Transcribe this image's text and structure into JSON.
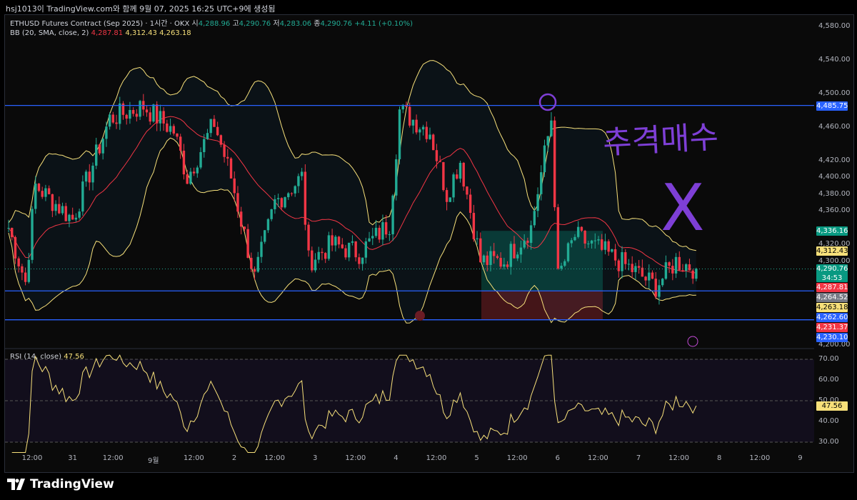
{
  "header": "hsj1013이 TradingView.com와 함께 9월 07, 2025 16:25 UTC+9에 생성됨",
  "legend": {
    "symbol": "ETHUSD Futures Contract (Sep 2025) · 1시간 · OKX",
    "o_label": "시",
    "o": "4,288.96",
    "h_label": "고",
    "h": "4,290.76",
    "l_label": "저",
    "l": "4,283.06",
    "c_label": "종",
    "c": "4,290.76",
    "change": "+4.11 (+0.10%)",
    "bb_label": "BB (20, SMA, close, 2)",
    "bb_basis": "4,287.81",
    "bb_upper": "4,312.43",
    "bb_lower": "4,263.18"
  },
  "rsi_legend": {
    "label": "RSI (14, close)",
    "value": "47.56"
  },
  "brand": "TradingView",
  "annotation": {
    "text": "추격매수",
    "mark": "X"
  },
  "colors": {
    "up": "#22ab94",
    "down": "#f23645",
    "bb": "#f7e07a",
    "basis": "#f23645",
    "hline": "#2962ff",
    "rsi": "#f7e07a",
    "drawing": "#7e3fd6"
  },
  "chart_data": {
    "type": "candlestick",
    "price_axis": {
      "ylim": [
        4200,
        4580
      ],
      "ticks": [
        "4,580.00",
        "4,540.00",
        "4,500.00",
        "4,460.00",
        "4,420.00",
        "4,400.00",
        "4,380.00",
        "4,360.00",
        "4,320.00",
        "4,300.00",
        "4,200.00"
      ],
      "tick_values": [
        4580,
        4540,
        4500,
        4460,
        4420,
        4400,
        4380,
        4360,
        4320,
        4300,
        4200
      ]
    },
    "price_badges": [
      {
        "text": "4,485.75",
        "value": 4485.75,
        "color": "#2962ff"
      },
      {
        "text": "4,336.16",
        "value": 4336.16,
        "color": "#089981"
      },
      {
        "text": "4,312.43",
        "value": 4312.43,
        "color": "#f7e07a"
      },
      {
        "text": "4,290.76",
        "sub": "34:53",
        "value": 4290.76,
        "color": "#089981"
      },
      {
        "text": "4,287.81",
        "value": 4287.81,
        "color": "#f23645"
      },
      {
        "text": "4,264.52",
        "value": 4264.52,
        "color": "#787b86"
      },
      {
        "text": "4,263.18",
        "value": 4263.18,
        "color": "#f7e07a"
      },
      {
        "text": "4,262.60",
        "value": 4262.6,
        "color": "#2962ff"
      },
      {
        "text": "4,231.37",
        "value": 4231.37,
        "color": "#f23645"
      },
      {
        "text": "4,230.10",
        "value": 4230.1,
        "color": "#2962ff"
      }
    ],
    "horizontal_lines": [
      4485.75,
      4264.52,
      4230.1
    ],
    "close_path_keypoints": [
      [
        0,
        4340
      ],
      [
        5,
        4275
      ],
      [
        8,
        4390
      ],
      [
        19,
        4350
      ],
      [
        30,
        4470
      ],
      [
        40,
        4485
      ],
      [
        49,
        4455
      ],
      [
        53,
        4400
      ],
      [
        61,
        4465
      ],
      [
        66,
        4400
      ],
      [
        73,
        4280
      ],
      [
        79,
        4370
      ],
      [
        87,
        4400
      ],
      [
        89,
        4300
      ],
      [
        96,
        4320
      ],
      [
        104,
        4310
      ],
      [
        113,
        4345
      ],
      [
        116,
        4480
      ],
      [
        125,
        4455
      ],
      [
        130,
        4380
      ],
      [
        134,
        4420
      ],
      [
        140,
        4300
      ],
      [
        147,
        4300
      ],
      [
        155,
        4340
      ],
      [
        161,
        4470
      ],
      [
        163,
        4280
      ],
      [
        168,
        4330
      ],
      [
        177,
        4310
      ],
      [
        185,
        4290
      ],
      [
        192,
        4270
      ],
      [
        198,
        4300
      ],
      [
        204,
        4291
      ]
    ],
    "bb": {
      "length": 20,
      "mult": 2
    },
    "rsi": {
      "length": 14,
      "ylim": [
        20,
        75
      ],
      "ticks": [
        "70.00",
        "60.00",
        "50.00",
        "40.00",
        "30.00"
      ],
      "tick_values": [
        70,
        60,
        50,
        40,
        30
      ],
      "last": "47.56"
    },
    "time_ticks": [
      "12:00",
      "31",
      "12:00",
      "9월",
      "12:00",
      "2",
      "12:00",
      "3",
      "12:00",
      "4",
      "12:00",
      "5",
      "12:00",
      "6",
      "12:00",
      "7",
      "12:00",
      "8",
      "12:00",
      "9"
    ]
  }
}
